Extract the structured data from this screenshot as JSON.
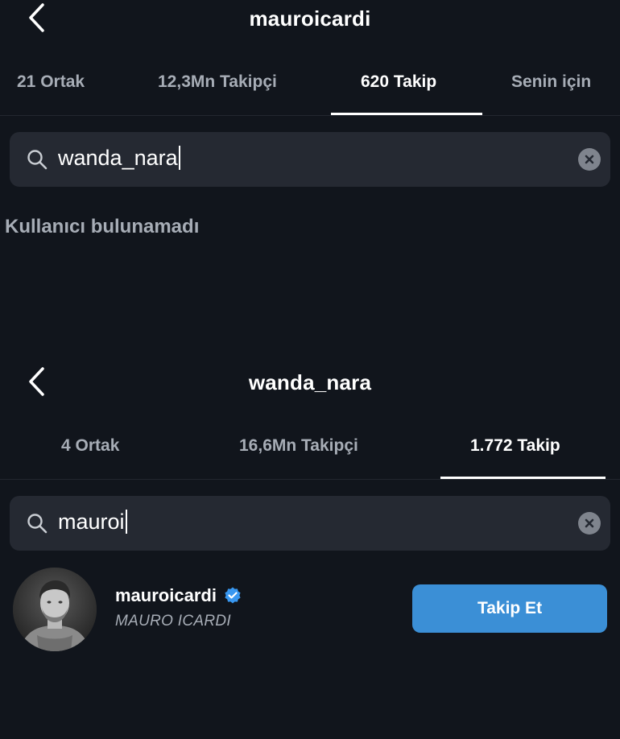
{
  "top": {
    "header": {
      "title": "mauroicardi"
    },
    "tabs": [
      {
        "label": "21 Ortak",
        "active": false
      },
      {
        "label": "12,3Mn Takipçi",
        "active": false
      },
      {
        "label": "620 Takip",
        "active": true
      },
      {
        "label": "Senin için",
        "active": false
      }
    ],
    "search": {
      "query": "wanda_nara"
    },
    "empty_message": "Kullanıcı bulunamadı"
  },
  "bottom": {
    "header": {
      "title": "wanda_nara"
    },
    "tabs": [
      {
        "label": "4 Ortak",
        "active": false
      },
      {
        "label": "16,6Mn Takipçi",
        "active": false
      },
      {
        "label": "1.772 Takip",
        "active": true
      }
    ],
    "search": {
      "query": "mauroi"
    },
    "result": {
      "username": "mauroicardi",
      "full_name": "MAURO ICARDI",
      "verified": true,
      "follow_label": "Takip Et"
    }
  },
  "icons": {
    "back": "chevron-left-icon",
    "search": "search-icon",
    "clear": "clear-icon",
    "verified": "verified-badge-icon"
  },
  "colors": {
    "background": "#11151c",
    "search_field": "#252932",
    "inactive_text": "#a7adb6",
    "accent": "#3b8fd6",
    "verified": "#3897f0"
  }
}
